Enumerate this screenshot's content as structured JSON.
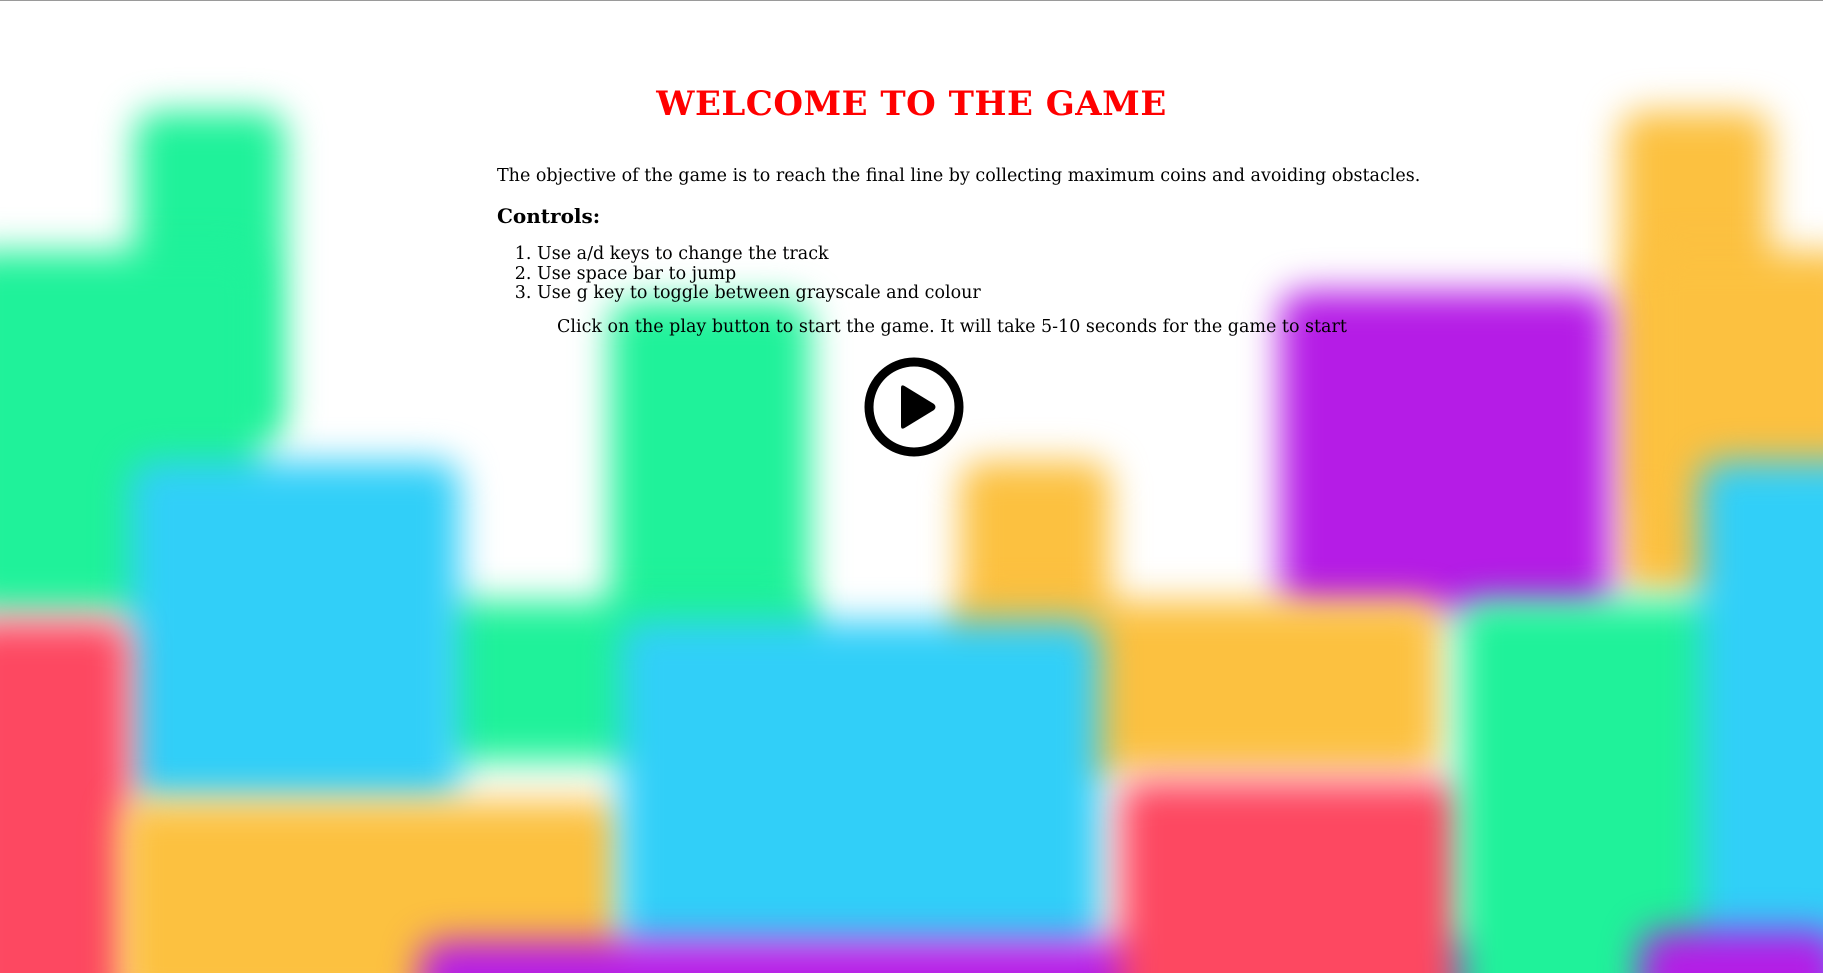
{
  "title": "WELCOME TO THE GAME",
  "objective": "The objective of the game is to reach the final line by collecting maximum coins and avoiding obstacles.",
  "controls": {
    "heading": "Controls:",
    "items": [
      "Use a/d keys to change the track",
      "Use space bar to jump",
      "Use g key to toggle between grayscale and colour"
    ]
  },
  "instructions": "Click on the play button to start the game. It will take 5-10 seconds for the game to start",
  "play_button": {
    "icon": "play-circle-icon"
  },
  "colors": {
    "title": "#ff0000",
    "text": "#000000",
    "page_background": "#ffffff",
    "block_green": "#1ff29a",
    "block_blue": "#31cff8",
    "block_orange": "#fcc140",
    "block_red": "#fd4861",
    "block_purple": "#b51ce6"
  }
}
